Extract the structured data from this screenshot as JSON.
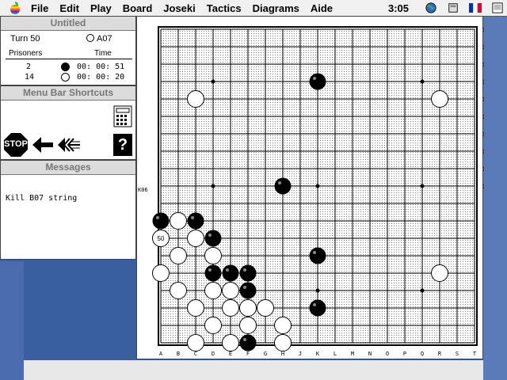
{
  "menubar": {
    "items": [
      "File",
      "Edit",
      "Play",
      "Board",
      "Joseki",
      "Tactics",
      "Diagrams",
      "Aide"
    ],
    "clock": "3:05"
  },
  "game_info": {
    "title": "Untitled",
    "turn_label": "Turn 50",
    "last_move": "A07",
    "prisoners_label": "Prisoners",
    "time_label": "Time",
    "black_prisoners": "2",
    "black_time": "00: 00: 51",
    "white_prisoners": "14",
    "white_time": "00: 00: 20"
  },
  "shortcuts": {
    "title": "Menu Bar Shortcuts",
    "stop_label": "STOP",
    "help_label": "?"
  },
  "messages": {
    "title": "Messages",
    "text": "Kill B07 string"
  },
  "board": {
    "size": 19,
    "columns": [
      "A",
      "B",
      "C",
      "D",
      "E",
      "F",
      "G",
      "H",
      "J",
      "K",
      "L",
      "M",
      "N",
      "O",
      "P",
      "Q",
      "R",
      "S",
      "T"
    ],
    "side_label": "K06",
    "last_move_number": "50",
    "black_stones": [
      "K16",
      "H10",
      "A8",
      "C8",
      "D7",
      "K6",
      "D5",
      "E5",
      "F5",
      "F4",
      "K3",
      "F1"
    ],
    "white_stones": [
      "C15",
      "R15",
      "B8",
      "A7",
      "C7",
      "B6",
      "D6",
      "A5",
      "R5",
      "B4",
      "D4",
      "E4",
      "C3",
      "E3",
      "F3",
      "G3",
      "D2",
      "F2",
      "H2",
      "C1",
      "E1",
      "H1"
    ],
    "hoshi": [
      "D16",
      "K16",
      "Q16",
      "D10",
      "K10",
      "Q10",
      "D4",
      "K4",
      "Q4"
    ]
  },
  "colors": {
    "black_stone": "#000000",
    "white_stone": "#ffffff",
    "grid": "#000000"
  }
}
